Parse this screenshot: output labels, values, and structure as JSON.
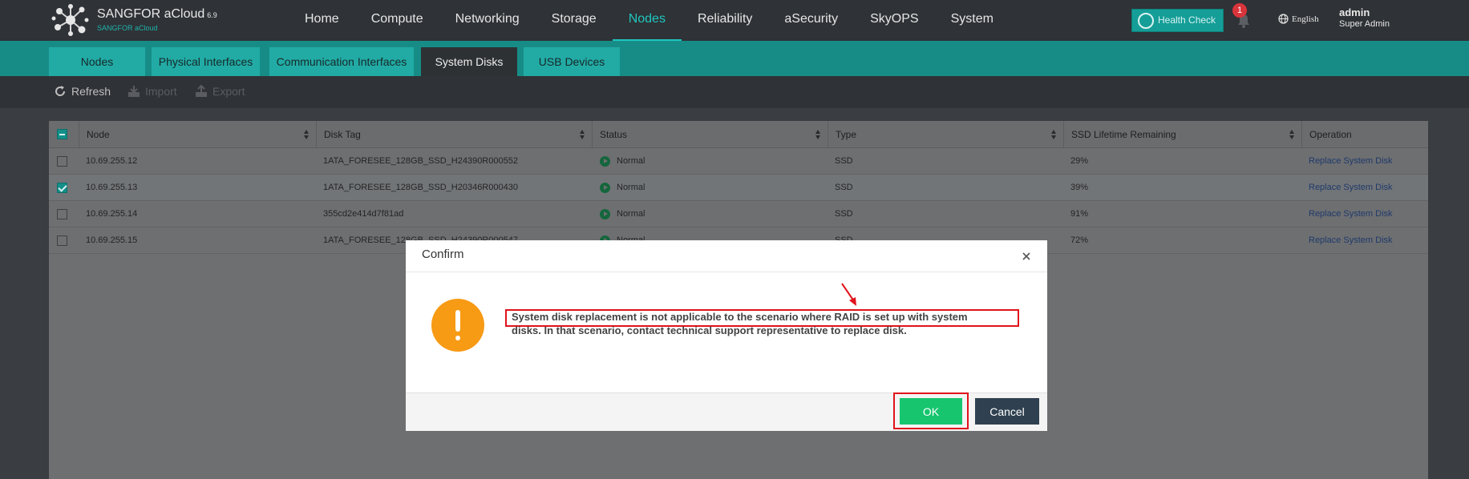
{
  "brand": {
    "name": "SANGFOR aCloud",
    "version": "6.9",
    "sub": "SANGFOR aCloud"
  },
  "nav": [
    {
      "label": "Home"
    },
    {
      "label": "Compute"
    },
    {
      "label": "Networking"
    },
    {
      "label": "Storage"
    },
    {
      "label": "Nodes",
      "active": true
    },
    {
      "label": "Reliability"
    },
    {
      "label": "aSecurity"
    },
    {
      "label": "SkyOPS"
    },
    {
      "label": "System"
    }
  ],
  "header": {
    "health_check": "Health Check",
    "notification_count": "1",
    "language": "English",
    "user_name": "admin",
    "user_role": "Super Admin",
    "accent_color": "#1ec6be"
  },
  "subtabs": [
    {
      "label": "Nodes"
    },
    {
      "label": "Physical Interfaces"
    },
    {
      "label": "Communication Interfaces"
    },
    {
      "label": "System Disks",
      "active": true
    },
    {
      "label": "USB Devices"
    }
  ],
  "toolbar": {
    "refresh": "Refresh",
    "import": "Import",
    "export": "Export"
  },
  "table": {
    "columns": [
      "Node",
      "Disk Tag",
      "Status",
      "Type",
      "SSD Lifetime Remaining",
      "Operation"
    ],
    "rows": [
      {
        "node": "10.69.255.12",
        "disk_tag": "1ATA_FORESEE_128GB_SSD_H24390R000552",
        "status": "Normal",
        "type": "SSD",
        "lifetime": "29%",
        "operation": "Replace System Disk",
        "checked": false
      },
      {
        "node": "10.69.255.13",
        "disk_tag": "1ATA_FORESEE_128GB_SSD_H20346R000430",
        "status": "Normal",
        "type": "SSD",
        "lifetime": "39%",
        "operation": "Replace System Disk",
        "checked": true
      },
      {
        "node": "10.69.255.14",
        "disk_tag": "355cd2e414d7f81ad",
        "status": "Normal",
        "type": "SSD",
        "lifetime": "91%",
        "operation": "Replace System Disk",
        "checked": false
      },
      {
        "node": "10.69.255.15",
        "disk_tag": "1ATA_FORESEE_128GB_SSD_H24390R000547",
        "status": "Normal",
        "type": "SSD",
        "lifetime": "72%",
        "operation": "Replace System Disk",
        "checked": false
      }
    ]
  },
  "dialog": {
    "title": "Confirm",
    "message_line1": "System disk replacement is not applicable to the scenario where RAID is set up with system",
    "message_line2": "disks. In that scenario, contact technical support representative to replace disk.",
    "ok": "OK",
    "cancel": "Cancel",
    "highlight_color": "#e0131b"
  }
}
